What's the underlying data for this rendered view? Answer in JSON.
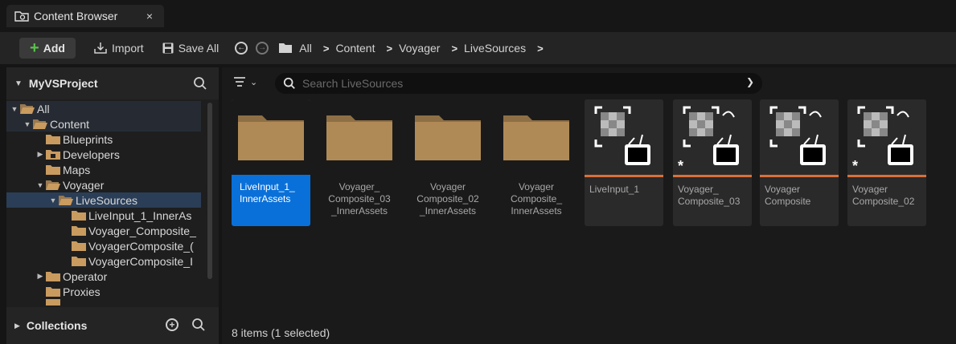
{
  "tab": {
    "title": "Content Browser",
    "close_glyph": "×",
    "icon": "content-browser-icon"
  },
  "toolbar": {
    "add_label": "Add",
    "import_label": "Import",
    "save_all_label": "Save All",
    "breadcrumb": [
      "All",
      "Content",
      "Voyager",
      "LiveSources"
    ],
    "separator": ">"
  },
  "left_panel": {
    "project_name": "MyVSProject",
    "collections_label": "Collections",
    "tree": [
      {
        "label": "All",
        "depth": 0,
        "expanded": true
      },
      {
        "label": "Content",
        "depth": 1,
        "expanded": true
      },
      {
        "label": "Blueprints",
        "depth": 2
      },
      {
        "label": "Developers",
        "depth": 2,
        "collapsed": true
      },
      {
        "label": "Maps",
        "depth": 2
      },
      {
        "label": "Voyager",
        "depth": 2,
        "expanded": true
      },
      {
        "label": "LiveSources",
        "depth": 3,
        "expanded": true,
        "selected": true
      },
      {
        "label": "LiveInput_1_InnerAs",
        "depth": 4
      },
      {
        "label": "Voyager_Composite_",
        "depth": 4
      },
      {
        "label": "VoyagerComposite_(",
        "depth": 4
      },
      {
        "label": "VoyagerComposite_I",
        "depth": 4
      },
      {
        "label": "Operator",
        "depth": 2,
        "collapsed": true
      },
      {
        "label": "Proxies",
        "depth": 2
      }
    ]
  },
  "search": {
    "placeholder": "Search LiveSources"
  },
  "assets": [
    {
      "kind": "folder",
      "label_lines": [
        "LiveInput_1_",
        "InnerAssets"
      ],
      "selected": true
    },
    {
      "kind": "folder",
      "label_lines": [
        "Voyager_",
        "Composite_03",
        "_InnerAssets"
      ]
    },
    {
      "kind": "folder",
      "label_lines": [
        "Voyager",
        "Composite_02",
        "_InnerAssets"
      ]
    },
    {
      "kind": "folder",
      "label_lines": [
        "Voyager",
        "Composite_",
        "InnerAssets"
      ]
    },
    {
      "kind": "asset",
      "label_lines": [
        "LiveInput_1"
      ],
      "modified": false
    },
    {
      "kind": "asset",
      "label_lines": [
        "Voyager_",
        "Composite_03"
      ],
      "modified": true
    },
    {
      "kind": "asset",
      "label_lines": [
        "Voyager",
        "Composite"
      ],
      "modified": false
    },
    {
      "kind": "asset",
      "label_lines": [
        "Voyager",
        "Composite_02"
      ],
      "modified": true
    }
  ],
  "status": {
    "text": "8 items (1 selected)"
  },
  "colors": {
    "accent": "#0a70d9",
    "folder": "#b08a56",
    "add_plus": "#58c14b",
    "asset_bar": "#d8703a"
  }
}
